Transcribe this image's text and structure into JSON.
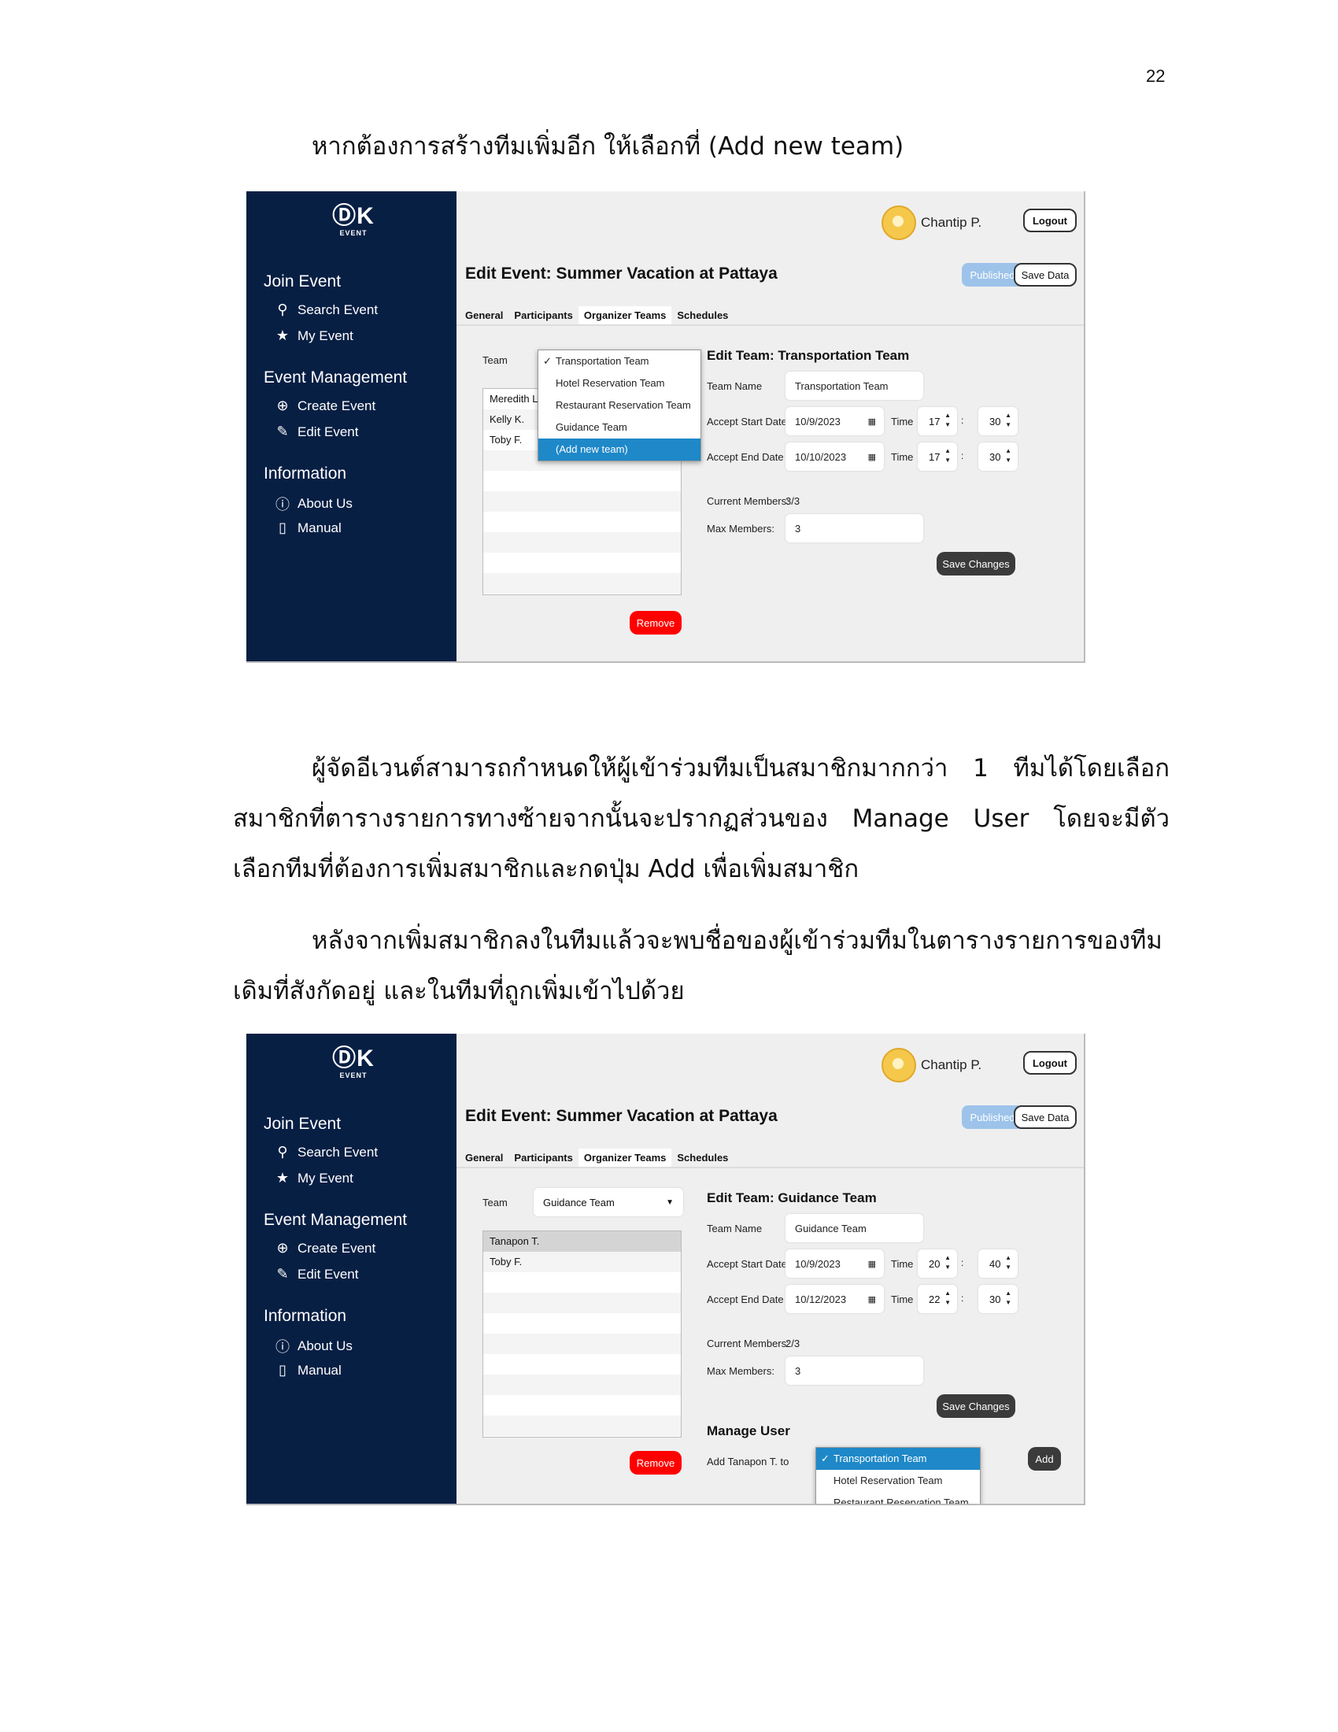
{
  "page_number": "22",
  "paragraphs": {
    "p1": "หากต้องการสร้างทีมเพิ่มอีก ให้เลือกที่ (Add new team)",
    "p2": "ผู้จัดอีเวนต์สามารถกำหนดให้ผู้เข้าร่วมทีมเป็นสมาชิกมากกว่า 1 ทีมได้โดยเลือกสมาชิกที่ตารางรายการทางซ้ายจากนั้นจะปรากฏส่วนของ Manage User โดยจะมีตัวเลือกทีมที่ต้องการเพิ่มสมาชิกและกดปุ่ม Add เพื่อเพิ่มสมาชิก",
    "p3": "หลังจากเพิ่มสมาชิกลงในทีมแล้วจะพบชื่อของผู้เข้าร่วมทีมในตารางรายการของทีมเดิมที่สังกัดอยู่ และในทีมที่ถูกเพิ่มเข้าไปด้วย"
  },
  "app": {
    "logo": "ⒹK",
    "logo_sub": "EVENT",
    "sidebar": {
      "join_event": "Join Event",
      "search_event": "Search Event",
      "my_event": "My Event",
      "event_management": "Event Management",
      "create_event": "Create Event",
      "edit_event": "Edit Event",
      "information": "Information",
      "about_us": "About Us",
      "manual": "Manual"
    },
    "user_name": "Chantip P.",
    "logout": "Logout",
    "page_title": "Edit Event: Summer Vacation at Pattaya",
    "published": "Published",
    "save_data": "Save Data",
    "tabs": [
      "General",
      "Participants",
      "Organizer Teams",
      "Schedules"
    ],
    "labels": {
      "team": "Team",
      "team_name": "Team Name",
      "accept_start": "Accept Start Date",
      "accept_end": "Accept End Date",
      "time": "Time",
      "current_members": "Current Members:",
      "max_members": "Max Members:",
      "save_changes": "Save Changes",
      "remove": "Remove",
      "colon": ":"
    }
  },
  "shot1": {
    "edit_heading": "Edit Team: Transportation Team",
    "team_name": "Transportation Team",
    "start_date": "10/9/2023",
    "start_hour": "17",
    "start_min": "30",
    "end_date": "10/10/2023",
    "end_hour": "17",
    "end_min": "30",
    "current_members": "3/3",
    "max_members": "3",
    "members": [
      "Meredith L.",
      "Kelly K.",
      "Toby F."
    ],
    "dropdown": [
      "Transportation Team",
      "Hotel Reservation Team",
      "Restaurant Reservation Team",
      "Guidance Team",
      "(Add new team)"
    ]
  },
  "shot2": {
    "selected_team": "Guidance Team",
    "edit_heading": "Edit Team: Guidance Team",
    "team_name": "Guidance Team",
    "start_date": "10/9/2023",
    "start_hour": "20",
    "start_min": "40",
    "end_date": "10/12/2023",
    "end_hour": "22",
    "end_min": "30",
    "current_members": "2/3",
    "max_members": "3",
    "members": [
      "Tanapon T.",
      "Toby F."
    ],
    "manage_user": "Manage User",
    "add_text": "Add Tanapon T. to",
    "add_button": "Add",
    "dropdown": [
      "Transportation Team",
      "Hotel Reservation Team",
      "Restaurant Reservation Team"
    ]
  },
  "icons": {
    "check": "✓",
    "caret": "▼",
    "calendar": "▦",
    "spin_arrows": "▲▼"
  }
}
